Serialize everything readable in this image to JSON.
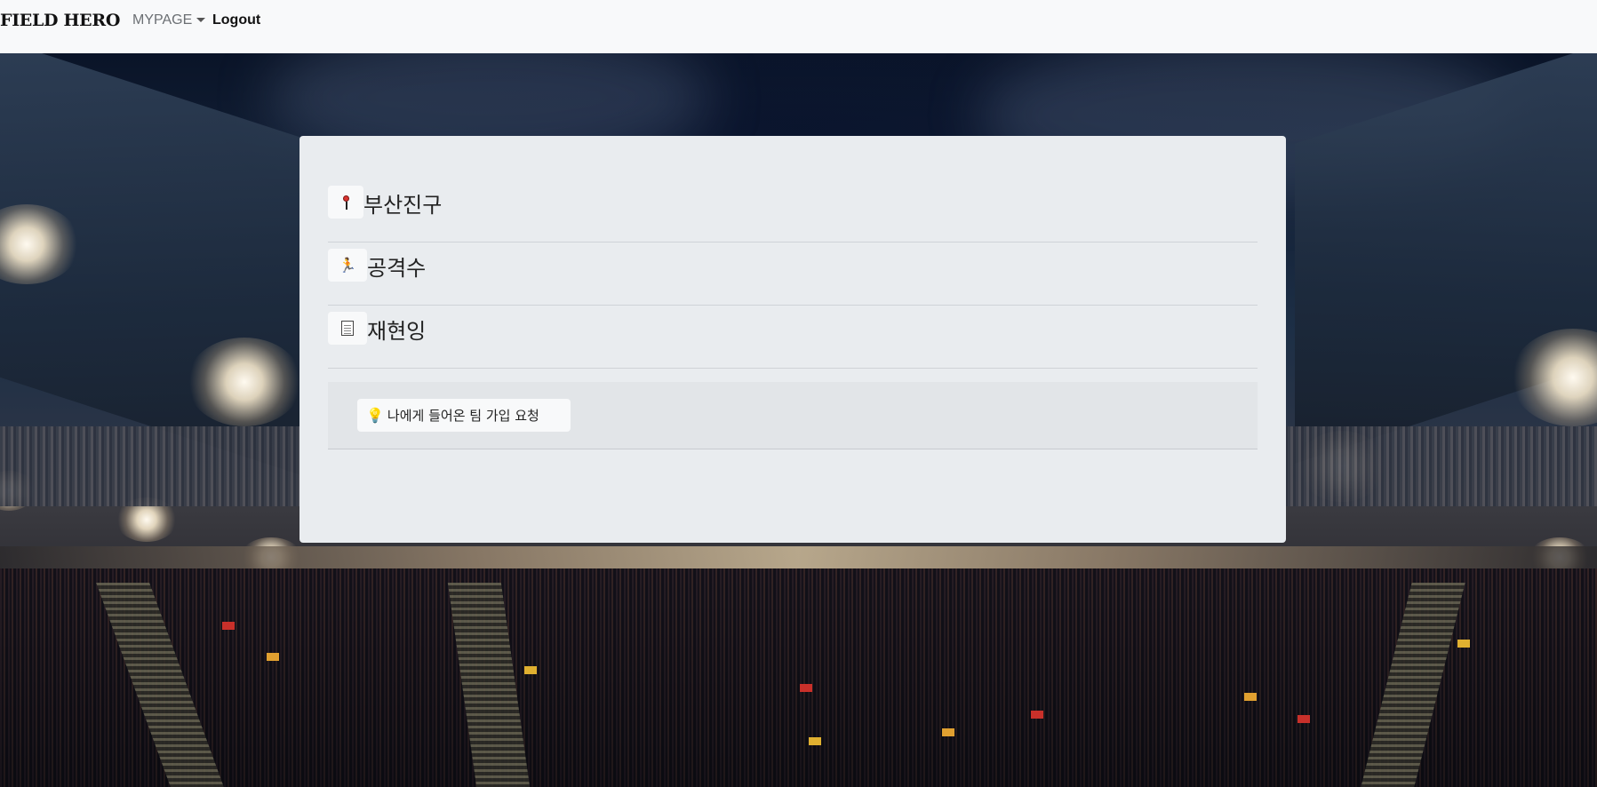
{
  "navbar": {
    "brand": "FIELD HERO",
    "mypage_label": "MYPAGE",
    "logout_label": "Logout"
  },
  "card": {
    "rows": [
      {
        "icon": "pushpin-icon",
        "title": "부산진구"
      },
      {
        "icon": "runner-icon",
        "title": "공격수"
      },
      {
        "icon": "document-icon",
        "title": "재현잉"
      }
    ],
    "request_button": {
      "icon": "lightbulb-icon",
      "label": "나에게 들어온 팀 가입 요청"
    }
  }
}
